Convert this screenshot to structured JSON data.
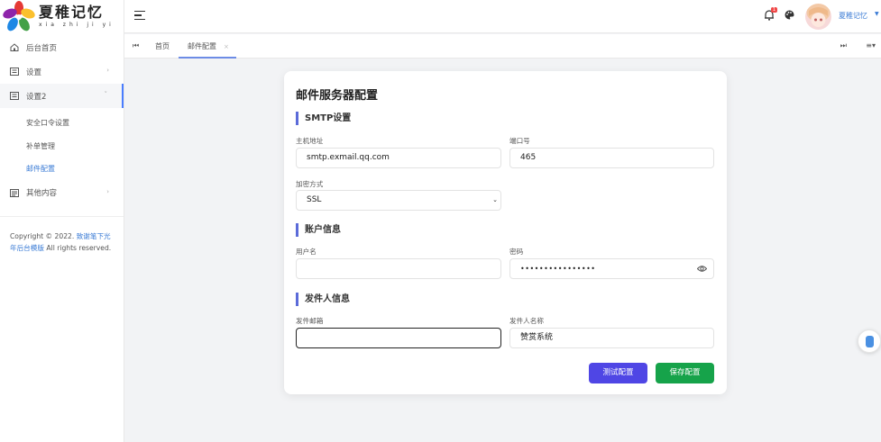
{
  "brand": {
    "name_cn": "夏稚记忆",
    "pinyin": "xia zhi ji yi"
  },
  "sidebar": {
    "items": [
      {
        "label": "后台首页",
        "icon": "home-icon"
      },
      {
        "label": "设置",
        "icon": "settings-card-icon"
      },
      {
        "label": "设置2",
        "icon": "settings-card-icon"
      },
      {
        "label": "其他内容",
        "icon": "content-icon"
      }
    ],
    "subitems": [
      {
        "label": "安全口令设置"
      },
      {
        "label": "补单管理"
      },
      {
        "label": "邮件配置"
      }
    ],
    "copyright": {
      "prefix": "Copyright © 2022.",
      "link": "致谢笔下光年后台模版",
      "suffix": "All rights reserved."
    }
  },
  "header": {
    "notification_count": "1",
    "username": "夏稚记忆"
  },
  "tabs": {
    "home": "首页",
    "active": "邮件配置"
  },
  "form": {
    "title": "邮件服务器配置",
    "smtp_section": "SMTP设置",
    "host_label": "主机地址",
    "host_value": "smtp.exmail.qq.com",
    "port_label": "端口号",
    "port_value": "465",
    "encryption_label": "加密方式",
    "encryption_value": "SSL",
    "account_section": "账户信息",
    "username_label": "用户名",
    "username_value": "",
    "password_label": "密码",
    "password_value": "••••••••••••••••",
    "sender_section": "发件人信息",
    "sender_email_label": "发件邮箱",
    "sender_email_value": "",
    "sender_name_label": "发件人名称",
    "sender_name_value": "赞赏系统",
    "test_button": "测试配置",
    "save_button": "保存配置"
  },
  "colors": {
    "accent": "#4f46e5",
    "success": "#16a34a",
    "link": "#3a7bd5",
    "section_bar": "#5b6bd9"
  }
}
